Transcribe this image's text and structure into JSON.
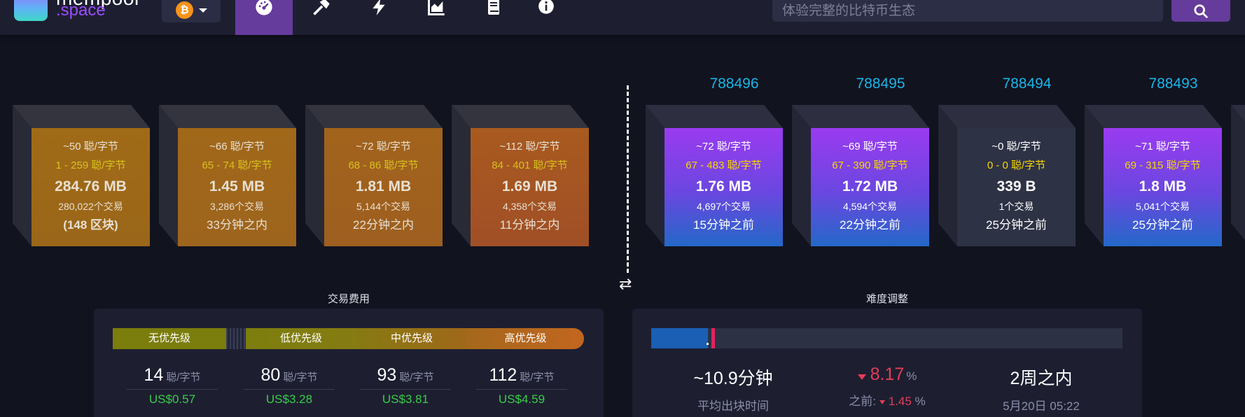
{
  "header": {
    "logo_line1": "mempool",
    "logo_line2": ".space",
    "network_symbol": "₿",
    "nav_icons": [
      "dashboard-icon",
      "hammer-icon",
      "lightning-icon",
      "graphs-icon",
      "docs-icon",
      "info-icon"
    ],
    "search_placeholder": "体验完整的比特币生态",
    "accent_color": "#653b9c"
  },
  "pending_blocks": [
    {
      "fee": "~50 聪/字节",
      "range": "1 - 259 聪/字节",
      "size": "284.76 MB",
      "tx_count": "280,022个交易",
      "time": "(148 区块)"
    },
    {
      "fee": "~66 聪/字节",
      "range": "65 - 74 聪/字节",
      "size": "1.45 MB",
      "tx_count": "3,286个交易",
      "time": "33分钟之内"
    },
    {
      "fee": "~72 聪/字节",
      "range": "68 - 86 聪/字节",
      "size": "1.81 MB",
      "tx_count": "5,144个交易",
      "time": "22分钟之内"
    },
    {
      "fee": "~112 聪/字节",
      "range": "84 - 401 聪/字节",
      "size": "1.69 MB",
      "tx_count": "4,358个交易",
      "time": "11分钟之内"
    }
  ],
  "mined_blocks": [
    {
      "height": "788496",
      "fee": "~72 聪/字节",
      "range": "67 - 483 聪/字节",
      "size": "1.76 MB",
      "tx_count": "4,697个交易",
      "time": "15分钟之前"
    },
    {
      "height": "788495",
      "fee": "~69 聪/字节",
      "range": "67 - 390 聪/字节",
      "size": "1.72 MB",
      "tx_count": "4,594个交易",
      "time": "22分钟之前"
    },
    {
      "height": "788494",
      "fee": "~0 聪/字节",
      "range": "0 - 0 聪/字节",
      "size": "339 B",
      "tx_count": "1个交易",
      "time": "25分钟之前"
    },
    {
      "height": "788493",
      "fee": "~71 聪/字节",
      "range": "69 - 315 聪/字节",
      "size": "1.8 MB",
      "tx_count": "5,041个交易",
      "time": "25分钟之前"
    }
  ],
  "fees": {
    "title": "交易费用",
    "priorities": [
      "无优先级",
      "低优先级",
      "中优先级",
      "高优先级"
    ],
    "unit": "聪/字节",
    "values": [
      {
        "rate": "14",
        "usd": "US$0.57"
      },
      {
        "rate": "80",
        "usd": "US$3.28"
      },
      {
        "rate": "93",
        "usd": "US$3.81"
      },
      {
        "rate": "112",
        "usd": "US$4.59"
      }
    ]
  },
  "difficulty": {
    "title": "难度调整",
    "progress_fraction": 0.12,
    "avg_block_time": "~10.9分钟",
    "avg_block_time_label": "平均出块时间",
    "change": "8.17",
    "change_unit": "%",
    "previous_label": "之前:",
    "previous_change": "1.45",
    "eta": "2周之内",
    "eta_date": "5月20日 05:22"
  }
}
